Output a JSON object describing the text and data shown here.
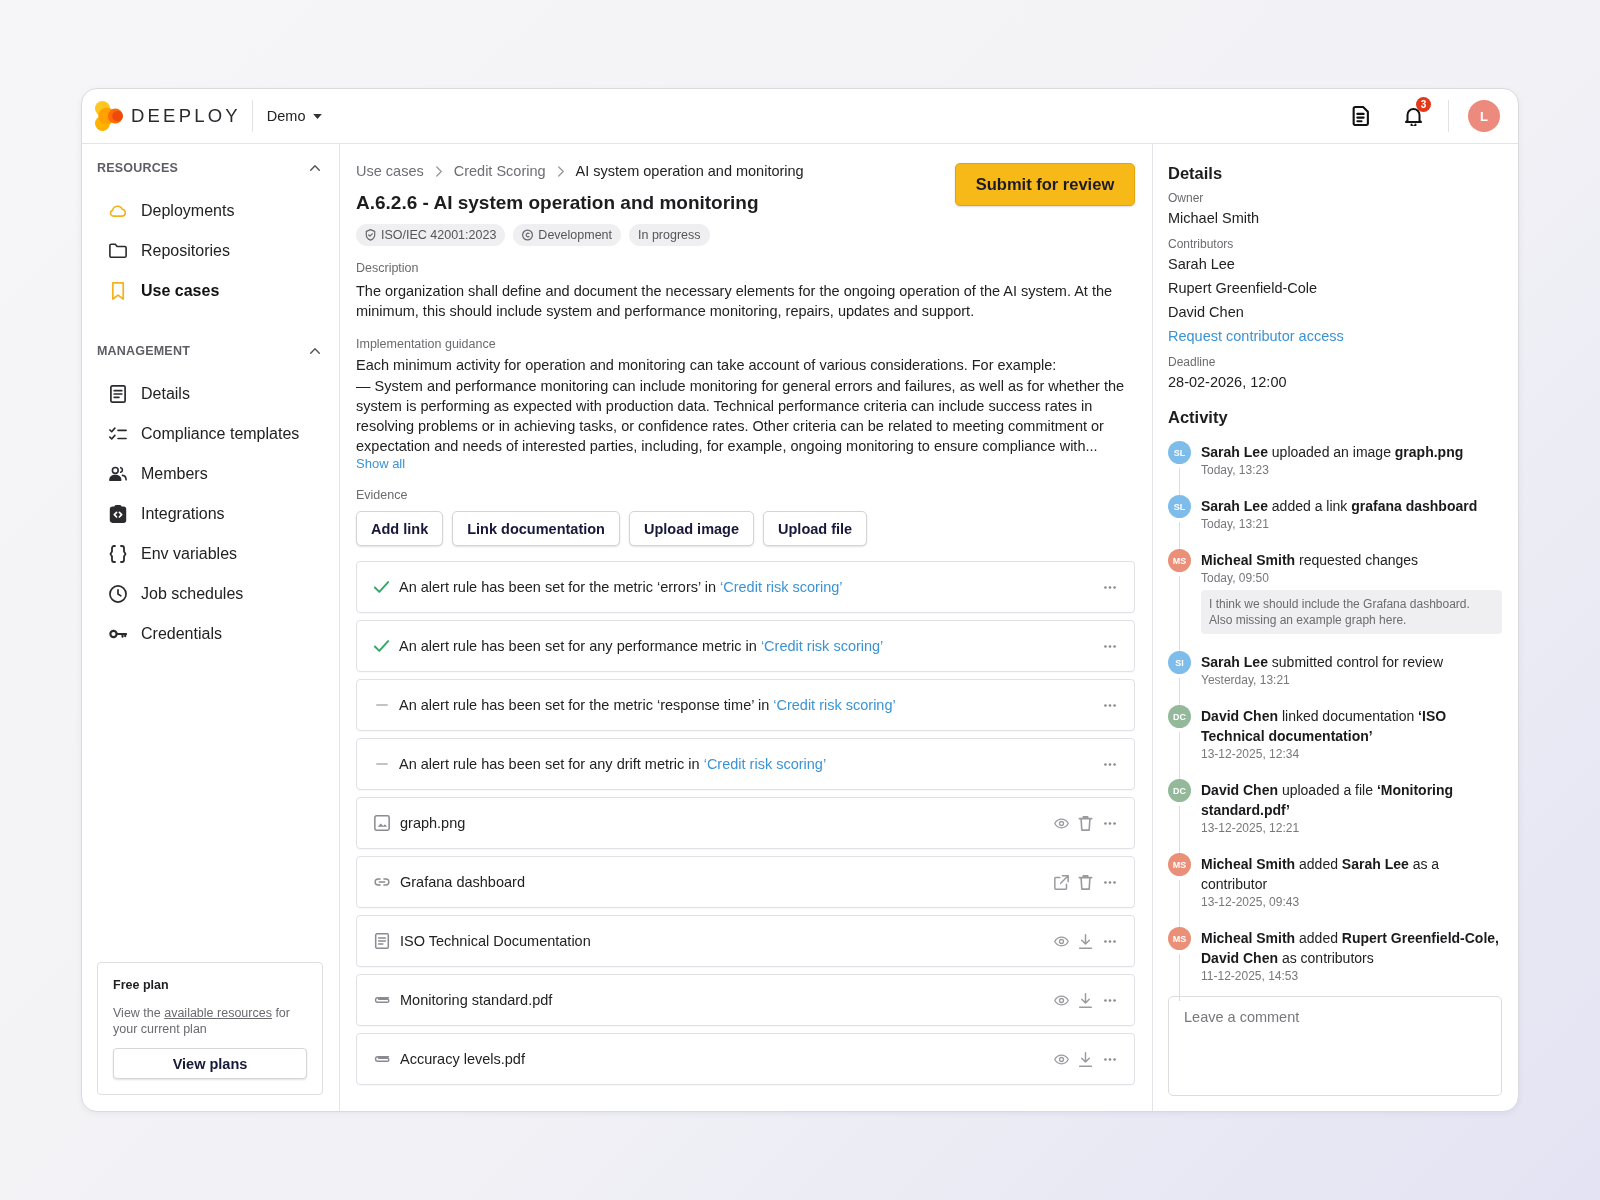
{
  "header": {
    "logo_text": "DEEPLOY",
    "workspace": "Demo",
    "notification_count": "3",
    "avatar": "L"
  },
  "sidebar": {
    "sections": [
      {
        "title": "RESOURCES",
        "expanded": true,
        "items": [
          {
            "label": "Deployments",
            "selected": false
          },
          {
            "label": "Repositories",
            "selected": false
          },
          {
            "label": "Use cases",
            "selected": true
          }
        ]
      },
      {
        "title": "MANAGEMENT",
        "expanded": true,
        "items": [
          {
            "label": "Details",
            "selected": false
          },
          {
            "label": "Compliance templates",
            "selected": false
          },
          {
            "label": "Members",
            "selected": false
          },
          {
            "label": "Integrations",
            "selected": false
          },
          {
            "label": "Env variables",
            "selected": false
          },
          {
            "label": "Job schedules",
            "selected": false
          },
          {
            "label": "Credentials",
            "selected": false
          }
        ]
      }
    ],
    "plan_card": {
      "title": "Free plan",
      "text": "View the",
      "link": "available resources",
      "text_after": "for your current plan",
      "button": "View plans"
    }
  },
  "main": {
    "breadcrumbs": [
      "Use cases",
      "Credit Scoring",
      "AI system operation and monitoring"
    ],
    "title": "A.6.2.6 - AI system operation and monitoring",
    "submit_button": "Submit for review",
    "tags": [
      {
        "kind": "standard",
        "label": "ISO/IEC 42001:2023"
      },
      {
        "kind": "stage",
        "label": "Development"
      },
      {
        "kind": "status",
        "label": "In progress"
      }
    ],
    "description": {
      "label": "Description",
      "text": "The organization shall define and document the necessary elements for the ongoing operation of the AI system. At the minimum, this should include system and performance monitoring, repairs, updates and support."
    },
    "guidance": {
      "label": "Implementation guidance",
      "paragraphs": [
        "Each minimum activity for operation and monitoring can take account of various considerations. For example:",
        "— System and performance monitoring can include monitoring for general errors and failures, as well as for whether the system is performing as expected with production data. Technical performance criteria can include success rates in resolving problems or in achieving tasks, or confidence rates. Other criteria can be related to meeting commitment or expectation and needs of interested parties, including, for example, ongoing monitoring to ensure compliance with..."
      ],
      "show_all": "Show all"
    },
    "evidence": {
      "label": "Evidence",
      "buttons": [
        "Add link",
        "Link documentation",
        "Upload image",
        "Upload file"
      ],
      "items": [
        {
          "kind": "check",
          "done": true,
          "text": "An alert rule has been set for the metric ‘errors’ in",
          "link": "‘Credit risk scoring’"
        },
        {
          "kind": "check",
          "done": true,
          "text": "An alert rule has been set for any performance metric in",
          "link": "‘Credit risk scoring’"
        },
        {
          "kind": "check",
          "done": false,
          "text": "An alert rule has been set for the metric ‘response time’ in",
          "link": "‘Credit risk scoring’"
        },
        {
          "kind": "check",
          "done": false,
          "text": "An alert rule has been set for any drift metric in",
          "link": "‘Credit risk scoring’"
        },
        {
          "kind": "image",
          "name": "graph.png"
        },
        {
          "kind": "link",
          "name": "Grafana dashboard"
        },
        {
          "kind": "document",
          "name": "ISO Technical Documentation"
        },
        {
          "kind": "file",
          "name": "Monitoring standard.pdf"
        },
        {
          "kind": "file",
          "name": "Accuracy levels.pdf"
        }
      ]
    }
  },
  "details": {
    "title": "Details",
    "owner_label": "Owner",
    "owner": "Michael Smith",
    "contributors_label": "Contributors",
    "contributors": [
      "Sarah Lee",
      "Rupert Greenfield-Cole",
      "David Chen"
    ],
    "request_link": "Request contributor access",
    "deadline_label": "Deadline",
    "deadline": "28-02-2026, 12:00"
  },
  "activity": {
    "title": "Activity",
    "items": [
      {
        "initials": "SL",
        "color": "#7ebde9",
        "text": "**Sarah Lee** uploaded an image **graph.png**",
        "time": "Today, 13:23"
      },
      {
        "initials": "SL",
        "color": "#7ebde9",
        "text": "**Sarah Lee** added a link **grafana dashboard**",
        "time": "Today, 13:21"
      },
      {
        "initials": "MS",
        "color": "#ea8f78",
        "text": "**Micheal Smith** requested changes",
        "time": "Today, 09:50",
        "comment": "I think we should include the Grafana dashboard. Also missing an example graph here."
      },
      {
        "initials": "SI",
        "color": "#7ebde9",
        "text": "**Sarah Lee** submitted control for review",
        "time": "Yesterday, 13:21"
      },
      {
        "initials": "DC",
        "color": "#93b89a",
        "text": "**David Chen** linked documentation **‘ISO Technical documentation’**",
        "time": "13-12-2025, 12:34"
      },
      {
        "initials": "DC",
        "color": "#93b89a",
        "text": "**David Chen** uploaded a file **‘Monitoring standard.pdf’**",
        "time": "13-12-2025, 12:21"
      },
      {
        "initials": "MS",
        "color": "#ea8f78",
        "text": "**Micheal Smith** added **Sarah Lee** as a contributor",
        "time": "13-12-2025, 09:43"
      },
      {
        "initials": "MS",
        "color": "#ea8f78",
        "text": "**Micheal Smith** added **Rupert Greenfield-Cole, David Chen** as contributors",
        "time": "11-12-2025, 14:53"
      }
    ],
    "comment_field": {
      "placeholder": "Leave a comment"
    }
  }
}
